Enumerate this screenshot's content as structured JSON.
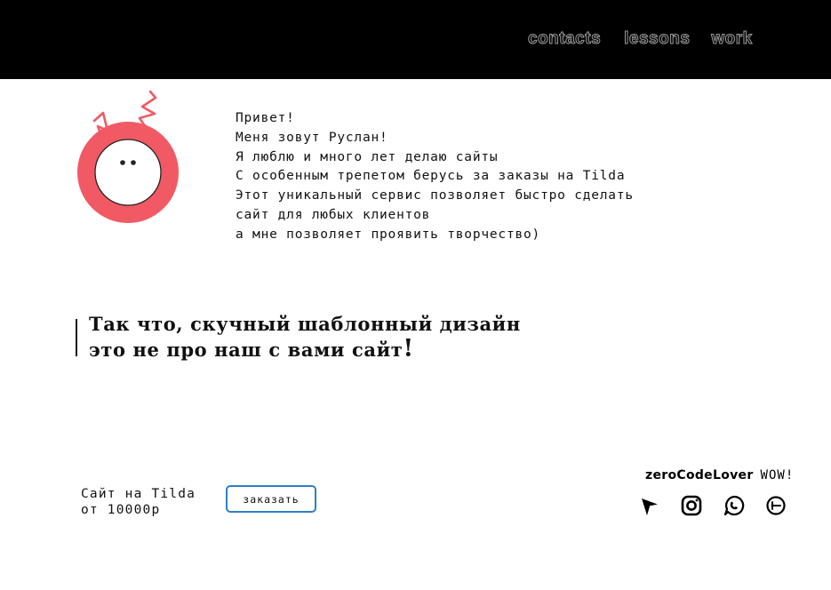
{
  "nav": {
    "items": [
      {
        "label": "contacts"
      },
      {
        "label": "lessons"
      },
      {
        "label": "work"
      }
    ]
  },
  "logo": {
    "icon": "smiley-face-with-lightning-icon",
    "ring_color": "#f15a64"
  },
  "intro": {
    "lines": [
      "Привет!",
      "Меня зовут Руслан!",
      "Я люблю и много лет делаю сайты",
      "С особенным трепетом берусь за заказы на Tilda",
      "Этот уникальный сервис позволяет быстро сделать",
      "сайт для любых клиентов",
      "а мне позволяет проявить творчество)"
    ]
  },
  "quote": {
    "line1": "Так что, скучный шаблонный дизайн",
    "line2": "это не про наш с вами сайт",
    "bang": "!"
  },
  "offer": {
    "line1": "Сайт на Tilda",
    "line2": "от 10000р",
    "button_label": "заказать",
    "button_border_color": "#2f7fc7"
  },
  "brand": {
    "name": "zeroCodeLover",
    "tagline": "WOW!"
  },
  "social": [
    {
      "icon": "telegram-icon"
    },
    {
      "icon": "instagram-icon"
    },
    {
      "icon": "whatsapp-icon"
    },
    {
      "icon": "timer-icon"
    }
  ]
}
